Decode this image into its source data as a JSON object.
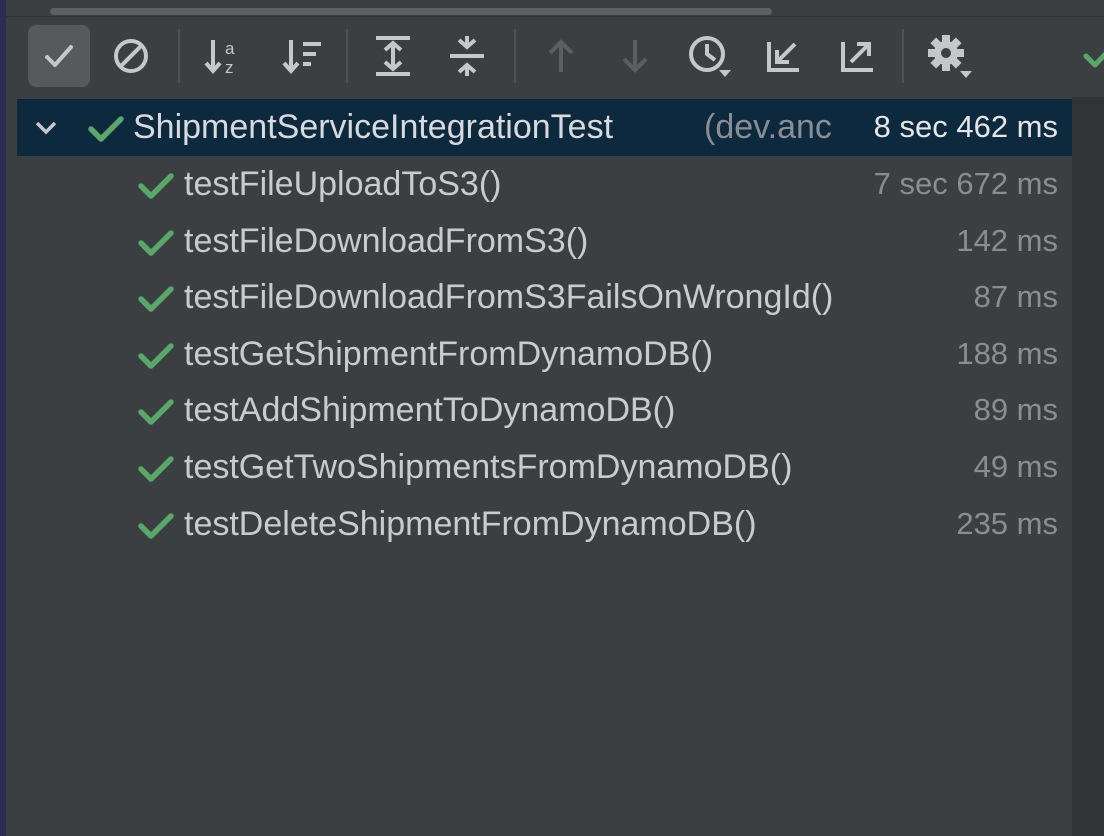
{
  "colors": {
    "pass_green": "#59a869",
    "selected_row": "#0d293e",
    "panel_bg": "#3c3f41",
    "icon_gray": "#c5c7ca"
  },
  "toolbar": {
    "buttons": [
      {
        "name": "show-passed-button",
        "icon": "checkmark-icon",
        "active": true
      },
      {
        "name": "show-ignored-button",
        "icon": "circle-slash-icon"
      },
      {
        "name": "sort-alphabetically-button",
        "icon": "sort-alpha-icon"
      },
      {
        "name": "sort-by-duration-button",
        "icon": "sort-duration-icon"
      },
      {
        "name": "expand-all-button",
        "icon": "expand-all-icon"
      },
      {
        "name": "collapse-all-button",
        "icon": "collapse-all-icon"
      },
      {
        "name": "previous-failed-button",
        "icon": "arrow-up-icon",
        "disabled": true
      },
      {
        "name": "next-failed-button",
        "icon": "arrow-down-icon",
        "disabled": true
      },
      {
        "name": "test-history-button",
        "icon": "clock-icon"
      },
      {
        "name": "import-tests-button",
        "icon": "import-arrow-icon"
      },
      {
        "name": "export-tests-button",
        "icon": "export-arrow-icon"
      },
      {
        "name": "settings-button",
        "icon": "gear-icon"
      }
    ]
  },
  "tree": {
    "root": {
      "name": "ShipmentServiceIntegrationTest",
      "package": "(dev.anc",
      "time": "8 sec 462 ms",
      "status": "passed",
      "expanded": true
    },
    "tests": [
      {
        "name": "testFileUploadToS3()",
        "time": "7 sec 672 ms",
        "status": "passed"
      },
      {
        "name": "testFileDownloadFromS3()",
        "time": "142 ms",
        "status": "passed"
      },
      {
        "name": "testFileDownloadFromS3FailsOnWrongId()",
        "time": "87 ms",
        "status": "passed"
      },
      {
        "name": "testGetShipmentFromDynamoDB()",
        "time": "188 ms",
        "status": "passed"
      },
      {
        "name": "testAddShipmentToDynamoDB()",
        "time": "89 ms",
        "status": "passed"
      },
      {
        "name": "testGetTwoShipmentsFromDynamoDB()",
        "time": "49 ms",
        "status": "passed"
      },
      {
        "name": "testDeleteShipmentFromDynamoDB()",
        "time": "235 ms",
        "status": "passed"
      }
    ]
  }
}
